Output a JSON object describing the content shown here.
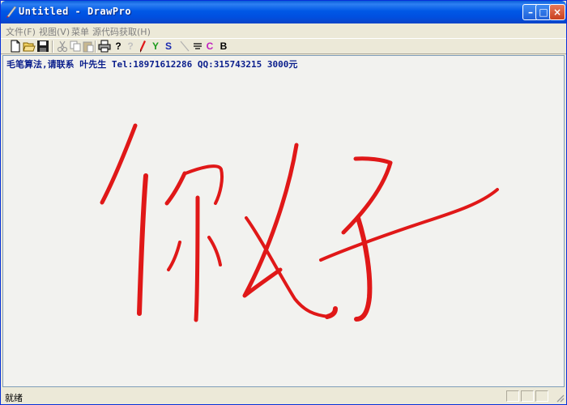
{
  "window": {
    "title": "Untitled - DrawPro",
    "minimize_glyph": "–",
    "maximize_glyph": "□",
    "close_glyph": "×"
  },
  "menu": {
    "items": [
      {
        "label": "文件(F)"
      },
      {
        "label": "视图(V)"
      },
      {
        "label": "菜单"
      },
      {
        "label": "源代码获取(H)"
      }
    ]
  },
  "toolbar": {
    "help_glyph": "?",
    "question_glyph": "?",
    "y_label": "Y",
    "s_label": "S",
    "c_label": "C",
    "b_label": "B",
    "y_color": "#1a9a1a",
    "s_color": "#1a2ab0",
    "c_color": "#c020c0",
    "b_color": "#000000"
  },
  "canvas": {
    "banner": "毛笔算法,请联系 叶先生 Tel:18971612286 QQ:315743215 3000元",
    "ink_color": "#e01818"
  },
  "status": {
    "text": "就绪"
  }
}
